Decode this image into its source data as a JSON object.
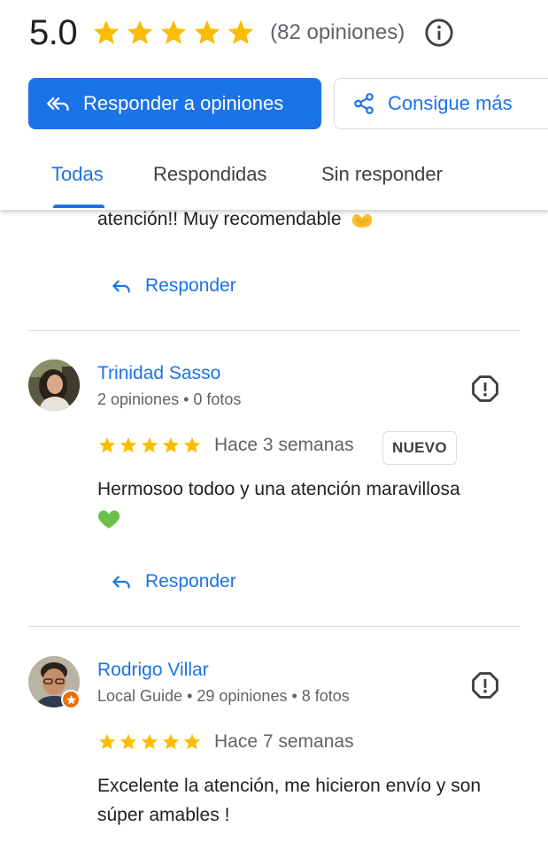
{
  "summary": {
    "rating": "5.0",
    "stars": 5,
    "count_text": "(82 opiniones)",
    "info_icon": "info-icon"
  },
  "actions": {
    "reply_label": "Responder a opiniones",
    "share_label": "Consigue más"
  },
  "tabs": [
    {
      "label": "Todas",
      "active": true
    },
    {
      "label": "Respondidas",
      "active": false
    },
    {
      "label": "Sin responder",
      "active": false
    }
  ],
  "previous_review": {
    "text_tail": "atención!! Muy recomendable",
    "emoji": "🫶",
    "reply_label": "Responder"
  },
  "reviews": [
    {
      "name": "Trinidad Sasso",
      "meta": "2 opiniones • 0 fotos",
      "stars": 5,
      "date": "Hace 3 semanas",
      "badge": "NUEVO",
      "text": "Hermosoo todoo y una atención maravillosa",
      "emoji": "💚",
      "reply_label": "Responder"
    },
    {
      "name": "Rodrigo Villar",
      "meta": "Local Guide • 29 opiniones • 8 fotos",
      "stars": 5,
      "date": "Hace 7 semanas",
      "text": "Excelente la atención, me hicieron envío y son súper amables !"
    }
  ],
  "colors": {
    "accent": "#1a73e8",
    "star": "#fbbc04",
    "text_secondary": "#5f6368",
    "divider": "#dadce0",
    "local_guide_badge": "#e8710a"
  }
}
